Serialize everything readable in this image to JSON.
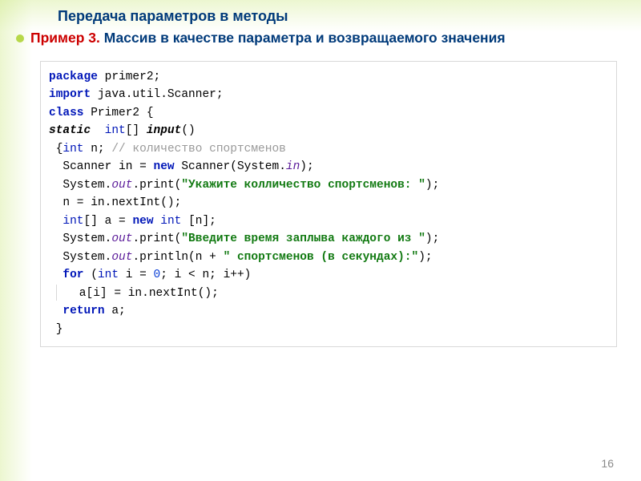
{
  "title": "Передача параметров в методы",
  "subtitle_red": "Пример 3.",
  "subtitle_blue": " Массив в качестве параметра и возвращаемого значения",
  "page_number": "16",
  "code": {
    "l1": {
      "kw": "package",
      "rest": " primer2;"
    },
    "l2": {
      "kw": "import",
      "rest": " java.util.Scanner;"
    },
    "l3": {
      "kw": "class",
      "name": " Primer2",
      "brace": " {"
    },
    "l4": {
      "kw": "static",
      "type": "  int",
      "brackets": "[]",
      "method": " input",
      "paren": "()"
    },
    "l5": {
      "open": "{",
      "type": "int",
      "var": " n; ",
      "comment": "// количество спортсменов"
    },
    "l6": {
      "a": " Scanner in = ",
      "kw": "new",
      "b": " Scanner(",
      "c": "System",
      "dot": ".",
      "field": "in",
      "d": ");"
    },
    "l7": {
      "a": " System",
      "dot": ".",
      "field": "out",
      "b": ".print(",
      "str": "\"Укажите колличество спортсменов: \"",
      "c": ");"
    },
    "l8": {
      "txt": " n = in.nextInt();"
    },
    "l9": {
      "type1": " int",
      "br": "[]",
      "a": " a = ",
      "kw": "new",
      "type2": " int ",
      "b": "[n];"
    },
    "l10": {
      "a": " System",
      "dot": ".",
      "field": "out",
      "b": ".print(",
      "str": "\"Введите время заплыва каждого из \"",
      "c": ");"
    },
    "l11": {
      "a": " System",
      "dot": ".",
      "field": "out",
      "b": ".println(n + ",
      "str": "\" спортсменов (в секундах):\"",
      "c": ");"
    },
    "l12": {
      "kw": " for",
      "a": " (",
      "type": "int",
      "b": " i = ",
      "n0": "0",
      "c": "; i < n; i++)"
    },
    "l13": {
      "txt": "   a[i] = in.nextInt();"
    },
    "l14": {
      "kw": " return",
      "txt": " a;"
    },
    "l15": {
      "txt": "}"
    }
  }
}
